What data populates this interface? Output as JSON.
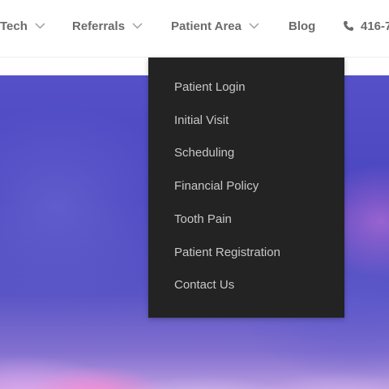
{
  "nav": {
    "items": [
      {
        "label": "Tech"
      },
      {
        "label": "Referrals"
      },
      {
        "label": "Patient Area"
      },
      {
        "label": "Blog"
      }
    ],
    "phone": "416-7"
  },
  "dropdown": {
    "items": [
      {
        "label": "Patient Login"
      },
      {
        "label": "Initial Visit"
      },
      {
        "label": "Scheduling"
      },
      {
        "label": "Financial Policy"
      },
      {
        "label": "Tooth Pain"
      },
      {
        "label": "Patient Registration"
      },
      {
        "label": "Contact Us"
      }
    ]
  },
  "icons": {
    "chevron": "chevron-down-icon",
    "phone": "phone-icon"
  },
  "colors": {
    "nav_text": "#6b6b6b",
    "dropdown_bg": "#232323",
    "dropdown_text": "#c8c8c8"
  }
}
